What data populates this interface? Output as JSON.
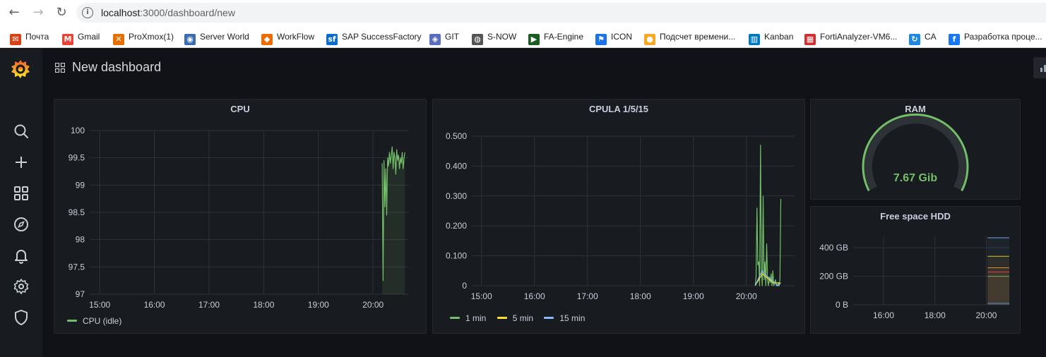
{
  "browser": {
    "url_host": "localhost",
    "url_path": ":3000/dashboard/new",
    "bookmarks": [
      {
        "label": "Почта",
        "icon": "mail-icon",
        "color": "#d84315"
      },
      {
        "label": "Gmail",
        "icon": "gmail-icon",
        "color": "#ea4335"
      },
      {
        "label": "ProXmox(1)",
        "icon": "proxmox-icon",
        "color": "#e57000"
      },
      {
        "label": "Server World",
        "icon": "server-world-icon",
        "color": "#3b6db3"
      },
      {
        "label": "WorkFlow",
        "icon": "workflow-icon",
        "color": "#ef6c00"
      },
      {
        "label": "SAP SuccessFactory",
        "icon": "sap-icon",
        "color": "#0a6ed1"
      },
      {
        "label": "GIT",
        "icon": "git-icon",
        "color": "#5b6dbf"
      },
      {
        "label": "S-NOW",
        "icon": "globe-icon",
        "color": "#555555"
      },
      {
        "label": "FA-Engine",
        "icon": "fa-engine-icon",
        "color": "#1b5e20"
      },
      {
        "label": "ICON",
        "icon": "flag-icon",
        "color": "#1a73e8"
      },
      {
        "label": "Подсчет времени...",
        "icon": "circle-icon",
        "color": "#f9a825"
      },
      {
        "label": "Kanban",
        "icon": "trello-icon",
        "color": "#0079bf"
      },
      {
        "label": "FortiAnalyzer-VM6...",
        "icon": "fortinet-icon",
        "color": "#d32f2f"
      },
      {
        "label": "CA",
        "icon": "refresh-icon",
        "color": "#1e88e5"
      },
      {
        "label": "Разработка проце...",
        "icon": "facebook-icon",
        "color": "#1877f2"
      }
    ]
  },
  "dashboard": {
    "title": "New dashboard"
  },
  "panels": {
    "cpu": {
      "title": "CPU",
      "legend": [
        {
          "name": "CPU (idle)",
          "color": "#73bf69"
        }
      ]
    },
    "cpula": {
      "title": "CPULA 1/5/15",
      "legend": [
        {
          "name": "1 min",
          "color": "#73bf69"
        },
        {
          "name": "5 min",
          "color": "#fade2a"
        },
        {
          "name": "15 min",
          "color": "#8ab8ff"
        }
      ]
    },
    "ram": {
      "title": "RAM",
      "value": "7.67 Gib",
      "color": "#73bf69"
    },
    "hdd": {
      "title": "Free space HDD"
    }
  },
  "chart_data": [
    {
      "type": "line",
      "title": "CPU",
      "x_ticks": [
        "15:00",
        "16:00",
        "17:00",
        "18:00",
        "19:00",
        "20:00"
      ],
      "y_ticks": [
        "100",
        "99.5",
        "99",
        "98.5",
        "98",
        "97.5",
        "97"
      ],
      "ylim": [
        97,
        100
      ],
      "series": [
        {
          "name": "CPU (idle)",
          "color": "#73bf69",
          "x": [
            "20:10",
            "20:11",
            "20:12",
            "20:13",
            "20:14",
            "20:15",
            "20:16",
            "20:17",
            "20:18",
            "20:19",
            "20:20",
            "20:21",
            "20:22",
            "20:23",
            "20:24",
            "20:25",
            "20:26",
            "20:27",
            "20:28",
            "20:29",
            "20:30",
            "20:31",
            "20:32",
            "20:33",
            "20:34",
            "20:35"
          ],
          "values": [
            99.4,
            97.25,
            99.45,
            98.6,
            99.3,
            98.45,
            99.5,
            99.35,
            99.6,
            99.4,
            99.55,
            99.7,
            99.3,
            99.6,
            99.5,
            99.2,
            99.65,
            99.45,
            99.55,
            99.3,
            99.5,
            99.4,
            99.6,
            99.3,
            99.5,
            99.6
          ]
        }
      ]
    },
    {
      "type": "line",
      "title": "CPULA 1/5/15",
      "x_ticks": [
        "15:00",
        "16:00",
        "17:00",
        "18:00",
        "19:00",
        "20:00"
      ],
      "y_ticks": [
        "0.500",
        "0.400",
        "0.300",
        "0.200",
        "0.100",
        "0"
      ],
      "ylim": [
        0,
        0.5
      ],
      "series": [
        {
          "name": "1 min",
          "color": "#73bf69",
          "x": [
            "20:10",
            "20:11",
            "20:12",
            "20:13",
            "20:14",
            "20:15",
            "20:16",
            "20:17",
            "20:18",
            "20:19",
            "20:20",
            "20:21",
            "20:22",
            "20:23",
            "20:24",
            "20:25",
            "20:26",
            "20:27",
            "20:28",
            "20:29",
            "20:30",
            "20:31",
            "20:32",
            "20:33",
            "20:34",
            "20:35",
            "20:36",
            "20:37",
            "20:38",
            "20:39"
          ],
          "values": [
            0.0,
            0.03,
            0.26,
            0.07,
            0.08,
            0.0,
            0.47,
            0.05,
            0.0,
            0.3,
            0.02,
            0.08,
            0.0,
            0.14,
            0.02,
            0.0,
            0.03,
            0.01,
            0.04,
            0.0,
            0.05,
            0.0,
            0.01,
            0.02,
            0.0,
            0.0,
            0.01,
            0.0,
            0.02,
            0.29
          ]
        },
        {
          "name": "5 min",
          "color": "#fade2a",
          "x": [
            "20:10",
            "20:14",
            "20:18",
            "20:22",
            "20:26",
            "20:30",
            "20:34",
            "20:38"
          ],
          "values": [
            0.0,
            0.02,
            0.04,
            0.03,
            0.02,
            0.01,
            0.01,
            0.01
          ]
        },
        {
          "name": "15 min",
          "color": "#8ab8ff",
          "x": [
            "20:10",
            "20:13",
            "20:16",
            "20:18",
            "20:20",
            "20:24",
            "20:28",
            "20:32",
            "20:36",
            "20:39"
          ],
          "values": [
            0.0,
            0.02,
            0.04,
            0.05,
            0.04,
            0.03,
            0.02,
            0.01,
            0.0,
            0.01
          ]
        }
      ]
    },
    {
      "type": "area",
      "title": "Free space HDD",
      "x_ticks": [
        "16:00",
        "18:00",
        "20:00"
      ],
      "y_ticks": [
        "400 GB",
        "200 GB",
        "0 B"
      ],
      "ylim_gb": [
        0,
        480
      ],
      "series": [
        {
          "color": "#8ab8ff",
          "value_gb": 470
        },
        {
          "color": "#fade2a",
          "value_gb": 340
        },
        {
          "color": "#ff9830",
          "value_gb": 260
        },
        {
          "color": "#f2495c",
          "value_gb": 230
        },
        {
          "color": "#73bf69",
          "value_gb": 200
        },
        {
          "color": "#5794f2",
          "value_gb": 10
        }
      ]
    }
  ]
}
